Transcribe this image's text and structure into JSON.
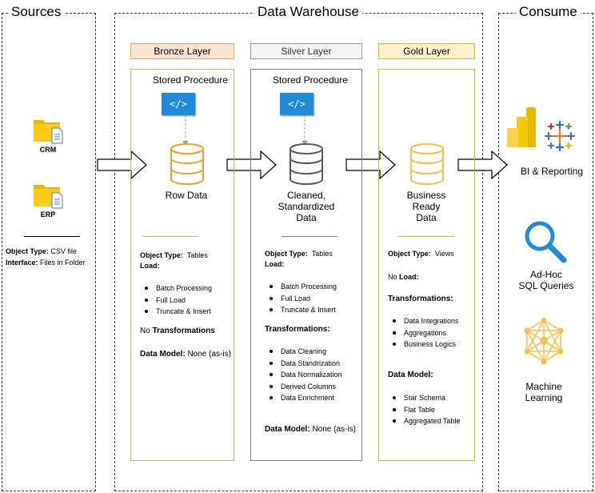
{
  "sections": {
    "sources": "Sources",
    "warehouse": "Data Warehouse",
    "consume": "Consume"
  },
  "sources": {
    "crm": "CRM",
    "erp": "ERP",
    "object_type_label": "Object Type:",
    "object_type_value": "CSV file",
    "interface_label": "Interface:",
    "interface_value": "Files in Folder"
  },
  "bronze": {
    "header": "Bronze Layer",
    "sp": "Stored Procedure",
    "code": "</>",
    "db_label": "Row Data",
    "object_type_label": "Object Type:",
    "object_type_value": "Tables",
    "load_label": "Load:",
    "load_items": [
      "Batch Processing",
      "Full Load",
      "Truncate & Insert"
    ],
    "no_prefix": "No",
    "transformations_label": "Transformations",
    "data_model_label": "Data Model:",
    "data_model_value": "None (as-is)"
  },
  "silver": {
    "header": "Silver Layer",
    "sp": "Stored Procedure",
    "code": "</>",
    "db_label_lines": [
      "Cleaned,",
      "Standardized",
      "Data"
    ],
    "object_type_label": "Object Type:",
    "object_type_value": "Tables",
    "load_label": "Load:",
    "load_items": [
      "Batch Processing",
      "Full Load",
      "Truncate & Insert"
    ],
    "transformations_label": "Transformations:",
    "transformation_items": [
      "Data Cleaning",
      "Data Standrization",
      "Data Normalization",
      "Derived Columns",
      "Data Enrichment"
    ],
    "data_model_label": "Data Model:",
    "data_model_value": "None (as-is)"
  },
  "gold": {
    "header": "Gold Layer",
    "db_label_lines": [
      "Business",
      "Ready",
      "Data"
    ],
    "object_type_label": "Object Type:",
    "object_type_value": "Views",
    "no_prefix": "No",
    "load_label": "Load:",
    "transformations_label": "Transformations:",
    "transformation_items": [
      "Data Integrations",
      "Aggregations",
      "Business Logics"
    ],
    "data_model_label": "Data Model:",
    "data_model_items": [
      "Star Schema",
      "Flat Table",
      "Aggregated Table"
    ]
  },
  "consume": {
    "bi": "BI & Reporting",
    "sql_lines": [
      "Ad-Hoc",
      "SQL Queries"
    ],
    "ml_lines": [
      "Machine",
      "Learning"
    ]
  },
  "colors": {
    "bronze_fill": "#fbe3d6",
    "bronze_border": "#e8a263",
    "silver_fill": "#f5f5f5",
    "silver_border": "#7f7f7f",
    "gold_fill": "#fff2cc",
    "gold_border": "#e6b422",
    "code_blue": "#1f8ad6",
    "db_orange": "#f0a030",
    "db_gray": "#595959",
    "db_gold": "#f0c04a"
  }
}
